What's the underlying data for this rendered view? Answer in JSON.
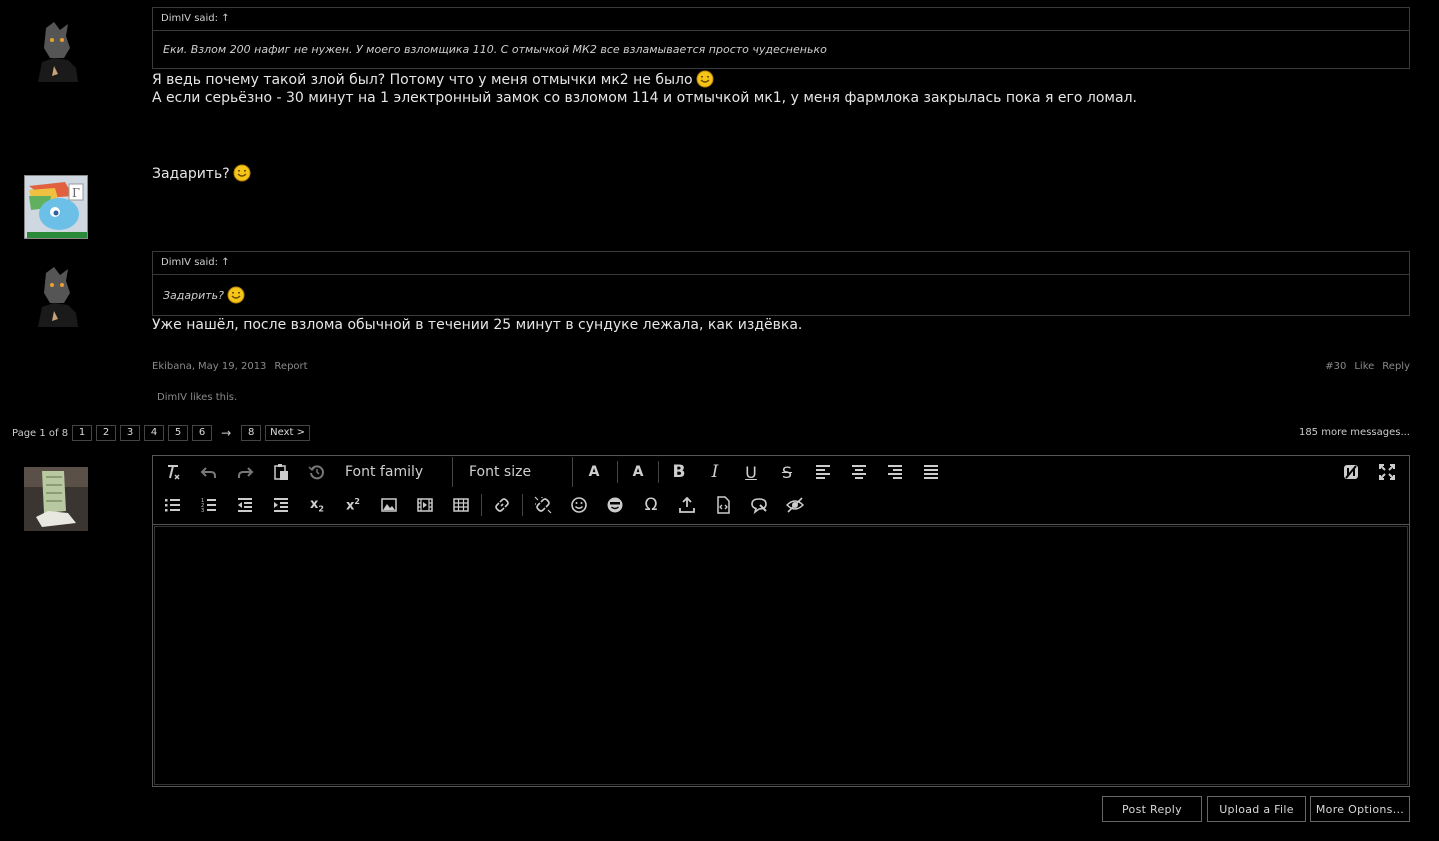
{
  "posts": [
    {
      "quote": {
        "attribution": "DimIV said: ↑",
        "text": "Еки. Взлом 200 нафиг не нужен. У моего взломщика 110. С отмычкой МК2 все взламывается просто чудесненько"
      },
      "lines": [
        "Я ведь почему такой злой был? Потому что у меня отмычки мк2 не было",
        "А если серьёзно - 30 минут на 1 электронный замок со взломом 114 и отмычкой мк1, у меня фармлока закрылась пока я его ломал."
      ]
    },
    {
      "lines": [
        "Задарить?"
      ]
    },
    {
      "quote": {
        "attribution": "DimIV said: ↑",
        "text": "Задарить?"
      },
      "lines": [
        "Уже нашёл, после взлома обычной в течении 25 минут в сундуке лежала, как издёвка."
      ],
      "meta": {
        "author": "Ekibana",
        "date": "May 19, 2013",
        "report": "Report",
        "post_number": "#30",
        "like": "Like",
        "reply": "Reply"
      },
      "likes_text": "DimIV likes this."
    }
  ],
  "pagination": {
    "label": "Page 1 of 8",
    "pages": [
      "1",
      "2",
      "3",
      "4",
      "5",
      "6"
    ],
    "ellipsis_arrow": "→",
    "last_page": "8",
    "next": "Next >",
    "more_messages": "185 more messages..."
  },
  "editor": {
    "font_family": "Font family",
    "font_size": "Font size",
    "buttons": {
      "post_reply": "Post Reply",
      "upload_file": "Upload a File",
      "more_options": "More Options..."
    }
  },
  "colors": {
    "background": "#000000",
    "text": "#e6e6e6",
    "border": "#3a3a3a",
    "smiley": "#f5c518"
  }
}
